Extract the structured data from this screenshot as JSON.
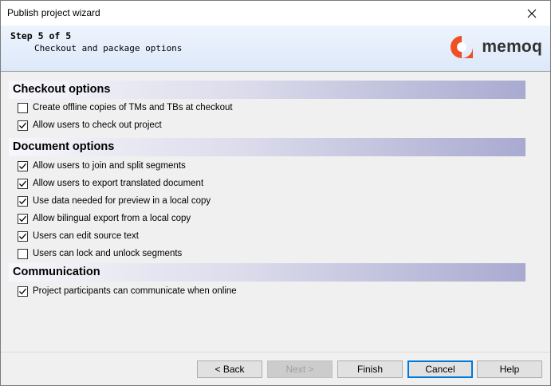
{
  "window": {
    "title": "Publish project wizard"
  },
  "header": {
    "step": "Step 5 of 5",
    "subtitle": "Checkout and package options",
    "logo_text": "memoq",
    "brand_color": "#f04e23"
  },
  "sections": [
    {
      "title": "Checkout options",
      "options": [
        {
          "label": "Create offline copies of TMs and TBs at checkout",
          "checked": false
        },
        {
          "label": "Allow users to check out project",
          "checked": true
        }
      ]
    },
    {
      "title": "Document options",
      "options": [
        {
          "label": "Allow users to join and split segments",
          "checked": true
        },
        {
          "label": "Allow users to export translated document",
          "checked": true
        },
        {
          "label": "Use data needed for preview in a local copy",
          "checked": true
        },
        {
          "label": "Allow bilingual export from a local copy",
          "checked": true
        },
        {
          "label": "Users can edit source text",
          "checked": true
        },
        {
          "label": "Users can lock and unlock segments",
          "checked": false
        }
      ]
    },
    {
      "title": "Communication",
      "options": [
        {
          "label": "Project participants can communicate when online",
          "checked": true
        }
      ]
    }
  ],
  "buttons": {
    "back": "< Back",
    "next": "Next >",
    "finish": "Finish",
    "cancel": "Cancel",
    "help": "Help"
  }
}
